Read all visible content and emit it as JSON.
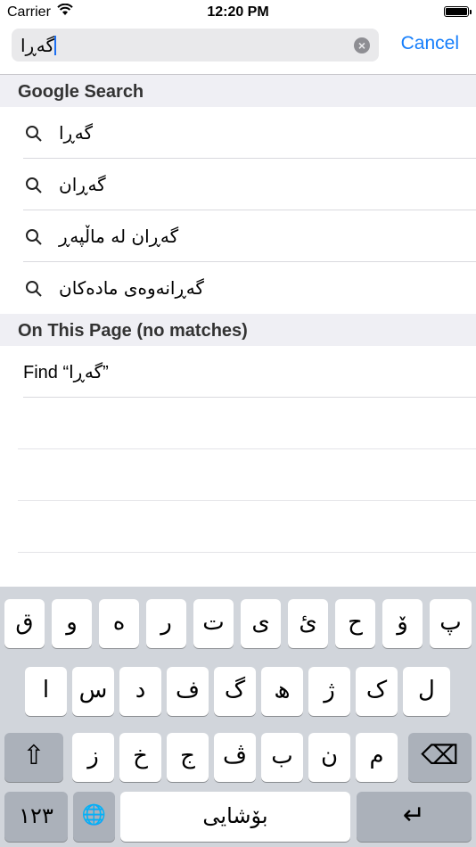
{
  "status": {
    "carrier": "Carrier",
    "time": "12:20 PM"
  },
  "search": {
    "value": "گەڕا",
    "cancel_label": "Cancel"
  },
  "google_section": {
    "title": "Google Search",
    "suggestions": [
      "گەڕا",
      "گەڕان",
      "گەڕان لە ماڵپەڕ",
      "گەڕانەوەی مادەکان"
    ]
  },
  "page_section": {
    "title": "On This Page (no matches)",
    "find_text": "Find “گەڕا”"
  },
  "keyboard": {
    "row1": [
      "ق",
      "و",
      "ە",
      "ر",
      "ت",
      "ی",
      "ئ",
      "ح",
      "ۆ",
      "پ"
    ],
    "row2": [
      "ا",
      "س",
      "د",
      "ف",
      "گ",
      "ھ",
      "ژ",
      "ک",
      "ل"
    ],
    "row3": [
      "ز",
      "خ",
      "ج",
      "ڤ",
      "ب",
      "ن",
      "م"
    ],
    "shift": "⇧",
    "delete": "⌫",
    "numbers": "١٢٣",
    "globe": "🌐",
    "space": "بۆشایی",
    "return": "↵"
  }
}
